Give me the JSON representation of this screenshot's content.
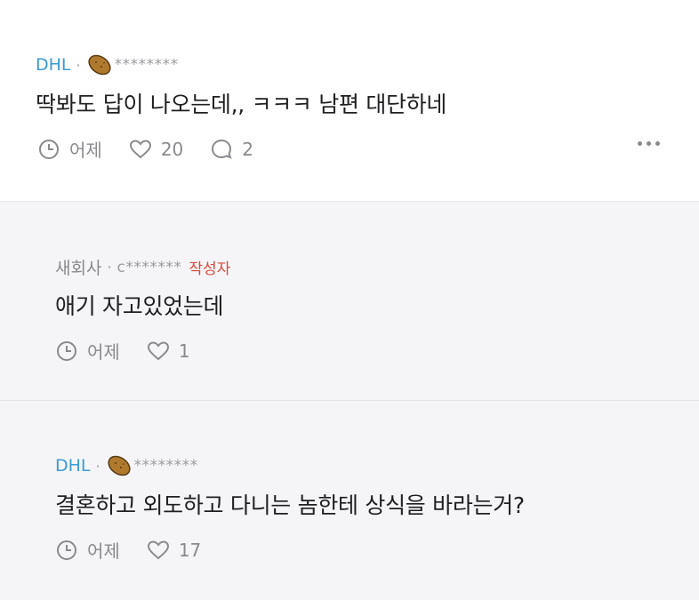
{
  "comments": [
    {
      "company": "DHL",
      "separator": "·",
      "username": "********",
      "text": "딱봐도 답이 나오는데,, ㅋㅋㅋ 남편 대단하네",
      "time": "어제",
      "likes": "20",
      "replies": "2"
    },
    {
      "company": "새회사",
      "separator": "·",
      "username": "c*******",
      "author_label": "작성자",
      "text": "애기 자고있었는데",
      "time": "어제",
      "likes": "1"
    },
    {
      "company": "DHL",
      "separator": "·",
      "username": "********",
      "text": "결혼하고 외도하고 다니는 놈한테 상식을 바라는거?",
      "time": "어제",
      "likes": "17"
    }
  ],
  "colors": {
    "company_link": "#3a9bd6",
    "author_badge": "#d94a3c",
    "muted": "#8a8a8e"
  },
  "icons": [
    "potato-badge-icon",
    "clock-icon",
    "heart-icon",
    "comment-icon",
    "more-icon"
  ]
}
